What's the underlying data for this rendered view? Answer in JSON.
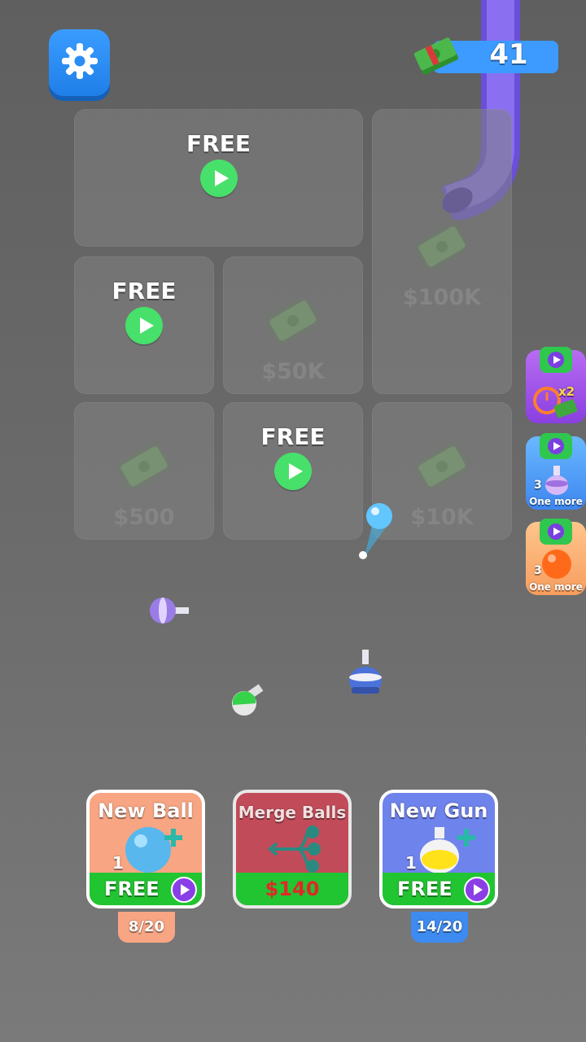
{
  "hud": {
    "money_value": "41"
  },
  "grid": {
    "cells": [
      {
        "type": "free",
        "label": "FREE"
      },
      {
        "type": "free",
        "label": "FREE"
      },
      {
        "type": "locked",
        "price": "$50K"
      },
      {
        "type": "locked",
        "price": "$100K"
      },
      {
        "type": "locked",
        "price": "$500"
      },
      {
        "type": "free",
        "label": "FREE"
      },
      {
        "type": "locked",
        "price": "$10K"
      }
    ]
  },
  "boosts": [
    {
      "name": "income-x2",
      "label": "x2"
    },
    {
      "name": "extra-gun",
      "count": "3",
      "label": "One more"
    },
    {
      "name": "extra-ball",
      "count": "3",
      "label": "One more"
    }
  ],
  "cards": {
    "new_ball": {
      "title": "New Ball",
      "count": "1",
      "button": "FREE",
      "progress": "8/20",
      "color": "#f8a583"
    },
    "merge_balls": {
      "title": "Merge Balls",
      "price": "$140",
      "color": "#c24b5a"
    },
    "new_gun": {
      "title": "New Gun",
      "count": "1",
      "button": "FREE",
      "progress": "14/20",
      "color": "#6f83ec"
    }
  },
  "colors": {
    "accent_blue": "#3d9bff",
    "play_green": "#47e06a",
    "pipe_purple": "#8a6ff0"
  }
}
